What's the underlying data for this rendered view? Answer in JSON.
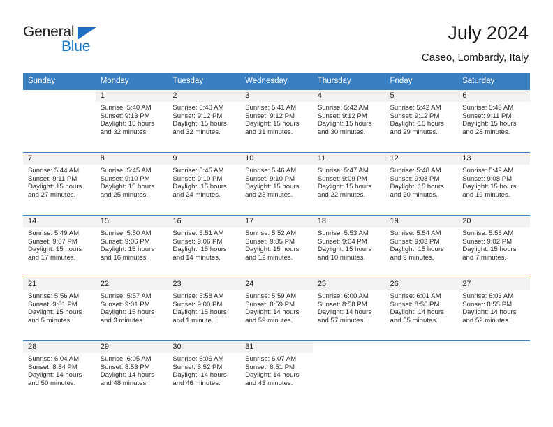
{
  "brand": {
    "name_part1": "General",
    "name_part2": "Blue",
    "accent_color": "#1878c8",
    "triangle_color": "#1f6fc4"
  },
  "header": {
    "title": "July 2024",
    "subtitle": "Caseo, Lombardy, Italy"
  },
  "calendar": {
    "header_color": "#3a7fc1",
    "weekday_headers": [
      "Sunday",
      "Monday",
      "Tuesday",
      "Wednesday",
      "Thursday",
      "Friday",
      "Saturday"
    ],
    "weeks": [
      [
        {
          "day": ""
        },
        {
          "day": "1",
          "sunrise": "Sunrise: 5:40 AM",
          "sunset": "Sunset: 9:13 PM",
          "daylight_1": "Daylight: 15 hours",
          "daylight_2": "and 32 minutes."
        },
        {
          "day": "2",
          "sunrise": "Sunrise: 5:40 AM",
          "sunset": "Sunset: 9:12 PM",
          "daylight_1": "Daylight: 15 hours",
          "daylight_2": "and 32 minutes."
        },
        {
          "day": "3",
          "sunrise": "Sunrise: 5:41 AM",
          "sunset": "Sunset: 9:12 PM",
          "daylight_1": "Daylight: 15 hours",
          "daylight_2": "and 31 minutes."
        },
        {
          "day": "4",
          "sunrise": "Sunrise: 5:42 AM",
          "sunset": "Sunset: 9:12 PM",
          "daylight_1": "Daylight: 15 hours",
          "daylight_2": "and 30 minutes."
        },
        {
          "day": "5",
          "sunrise": "Sunrise: 5:42 AM",
          "sunset": "Sunset: 9:12 PM",
          "daylight_1": "Daylight: 15 hours",
          "daylight_2": "and 29 minutes."
        },
        {
          "day": "6",
          "sunrise": "Sunrise: 5:43 AM",
          "sunset": "Sunset: 9:11 PM",
          "daylight_1": "Daylight: 15 hours",
          "daylight_2": "and 28 minutes."
        }
      ],
      [
        {
          "day": "7",
          "sunrise": "Sunrise: 5:44 AM",
          "sunset": "Sunset: 9:11 PM",
          "daylight_1": "Daylight: 15 hours",
          "daylight_2": "and 27 minutes."
        },
        {
          "day": "8",
          "sunrise": "Sunrise: 5:45 AM",
          "sunset": "Sunset: 9:10 PM",
          "daylight_1": "Daylight: 15 hours",
          "daylight_2": "and 25 minutes."
        },
        {
          "day": "9",
          "sunrise": "Sunrise: 5:45 AM",
          "sunset": "Sunset: 9:10 PM",
          "daylight_1": "Daylight: 15 hours",
          "daylight_2": "and 24 minutes."
        },
        {
          "day": "10",
          "sunrise": "Sunrise: 5:46 AM",
          "sunset": "Sunset: 9:10 PM",
          "daylight_1": "Daylight: 15 hours",
          "daylight_2": "and 23 minutes."
        },
        {
          "day": "11",
          "sunrise": "Sunrise: 5:47 AM",
          "sunset": "Sunset: 9:09 PM",
          "daylight_1": "Daylight: 15 hours",
          "daylight_2": "and 22 minutes."
        },
        {
          "day": "12",
          "sunrise": "Sunrise: 5:48 AM",
          "sunset": "Sunset: 9:08 PM",
          "daylight_1": "Daylight: 15 hours",
          "daylight_2": "and 20 minutes."
        },
        {
          "day": "13",
          "sunrise": "Sunrise: 5:49 AM",
          "sunset": "Sunset: 9:08 PM",
          "daylight_1": "Daylight: 15 hours",
          "daylight_2": "and 19 minutes."
        }
      ],
      [
        {
          "day": "14",
          "sunrise": "Sunrise: 5:49 AM",
          "sunset": "Sunset: 9:07 PM",
          "daylight_1": "Daylight: 15 hours",
          "daylight_2": "and 17 minutes."
        },
        {
          "day": "15",
          "sunrise": "Sunrise: 5:50 AM",
          "sunset": "Sunset: 9:06 PM",
          "daylight_1": "Daylight: 15 hours",
          "daylight_2": "and 16 minutes."
        },
        {
          "day": "16",
          "sunrise": "Sunrise: 5:51 AM",
          "sunset": "Sunset: 9:06 PM",
          "daylight_1": "Daylight: 15 hours",
          "daylight_2": "and 14 minutes."
        },
        {
          "day": "17",
          "sunrise": "Sunrise: 5:52 AM",
          "sunset": "Sunset: 9:05 PM",
          "daylight_1": "Daylight: 15 hours",
          "daylight_2": "and 12 minutes."
        },
        {
          "day": "18",
          "sunrise": "Sunrise: 5:53 AM",
          "sunset": "Sunset: 9:04 PM",
          "daylight_1": "Daylight: 15 hours",
          "daylight_2": "and 10 minutes."
        },
        {
          "day": "19",
          "sunrise": "Sunrise: 5:54 AM",
          "sunset": "Sunset: 9:03 PM",
          "daylight_1": "Daylight: 15 hours",
          "daylight_2": "and 9 minutes."
        },
        {
          "day": "20",
          "sunrise": "Sunrise: 5:55 AM",
          "sunset": "Sunset: 9:02 PM",
          "daylight_1": "Daylight: 15 hours",
          "daylight_2": "and 7 minutes."
        }
      ],
      [
        {
          "day": "21",
          "sunrise": "Sunrise: 5:56 AM",
          "sunset": "Sunset: 9:01 PM",
          "daylight_1": "Daylight: 15 hours",
          "daylight_2": "and 5 minutes."
        },
        {
          "day": "22",
          "sunrise": "Sunrise: 5:57 AM",
          "sunset": "Sunset: 9:01 PM",
          "daylight_1": "Daylight: 15 hours",
          "daylight_2": "and 3 minutes."
        },
        {
          "day": "23",
          "sunrise": "Sunrise: 5:58 AM",
          "sunset": "Sunset: 9:00 PM",
          "daylight_1": "Daylight: 15 hours",
          "daylight_2": "and 1 minute."
        },
        {
          "day": "24",
          "sunrise": "Sunrise: 5:59 AM",
          "sunset": "Sunset: 8:59 PM",
          "daylight_1": "Daylight: 14 hours",
          "daylight_2": "and 59 minutes."
        },
        {
          "day": "25",
          "sunrise": "Sunrise: 6:00 AM",
          "sunset": "Sunset: 8:58 PM",
          "daylight_1": "Daylight: 14 hours",
          "daylight_2": "and 57 minutes."
        },
        {
          "day": "26",
          "sunrise": "Sunrise: 6:01 AM",
          "sunset": "Sunset: 8:56 PM",
          "daylight_1": "Daylight: 14 hours",
          "daylight_2": "and 55 minutes."
        },
        {
          "day": "27",
          "sunrise": "Sunrise: 6:03 AM",
          "sunset": "Sunset: 8:55 PM",
          "daylight_1": "Daylight: 14 hours",
          "daylight_2": "and 52 minutes."
        }
      ],
      [
        {
          "day": "28",
          "sunrise": "Sunrise: 6:04 AM",
          "sunset": "Sunset: 8:54 PM",
          "daylight_1": "Daylight: 14 hours",
          "daylight_2": "and 50 minutes."
        },
        {
          "day": "29",
          "sunrise": "Sunrise: 6:05 AM",
          "sunset": "Sunset: 8:53 PM",
          "daylight_1": "Daylight: 14 hours",
          "daylight_2": "and 48 minutes."
        },
        {
          "day": "30",
          "sunrise": "Sunrise: 6:06 AM",
          "sunset": "Sunset: 8:52 PM",
          "daylight_1": "Daylight: 14 hours",
          "daylight_2": "and 46 minutes."
        },
        {
          "day": "31",
          "sunrise": "Sunrise: 6:07 AM",
          "sunset": "Sunset: 8:51 PM",
          "daylight_1": "Daylight: 14 hours",
          "daylight_2": "and 43 minutes."
        },
        {
          "day": ""
        },
        {
          "day": ""
        },
        {
          "day": ""
        }
      ]
    ]
  }
}
